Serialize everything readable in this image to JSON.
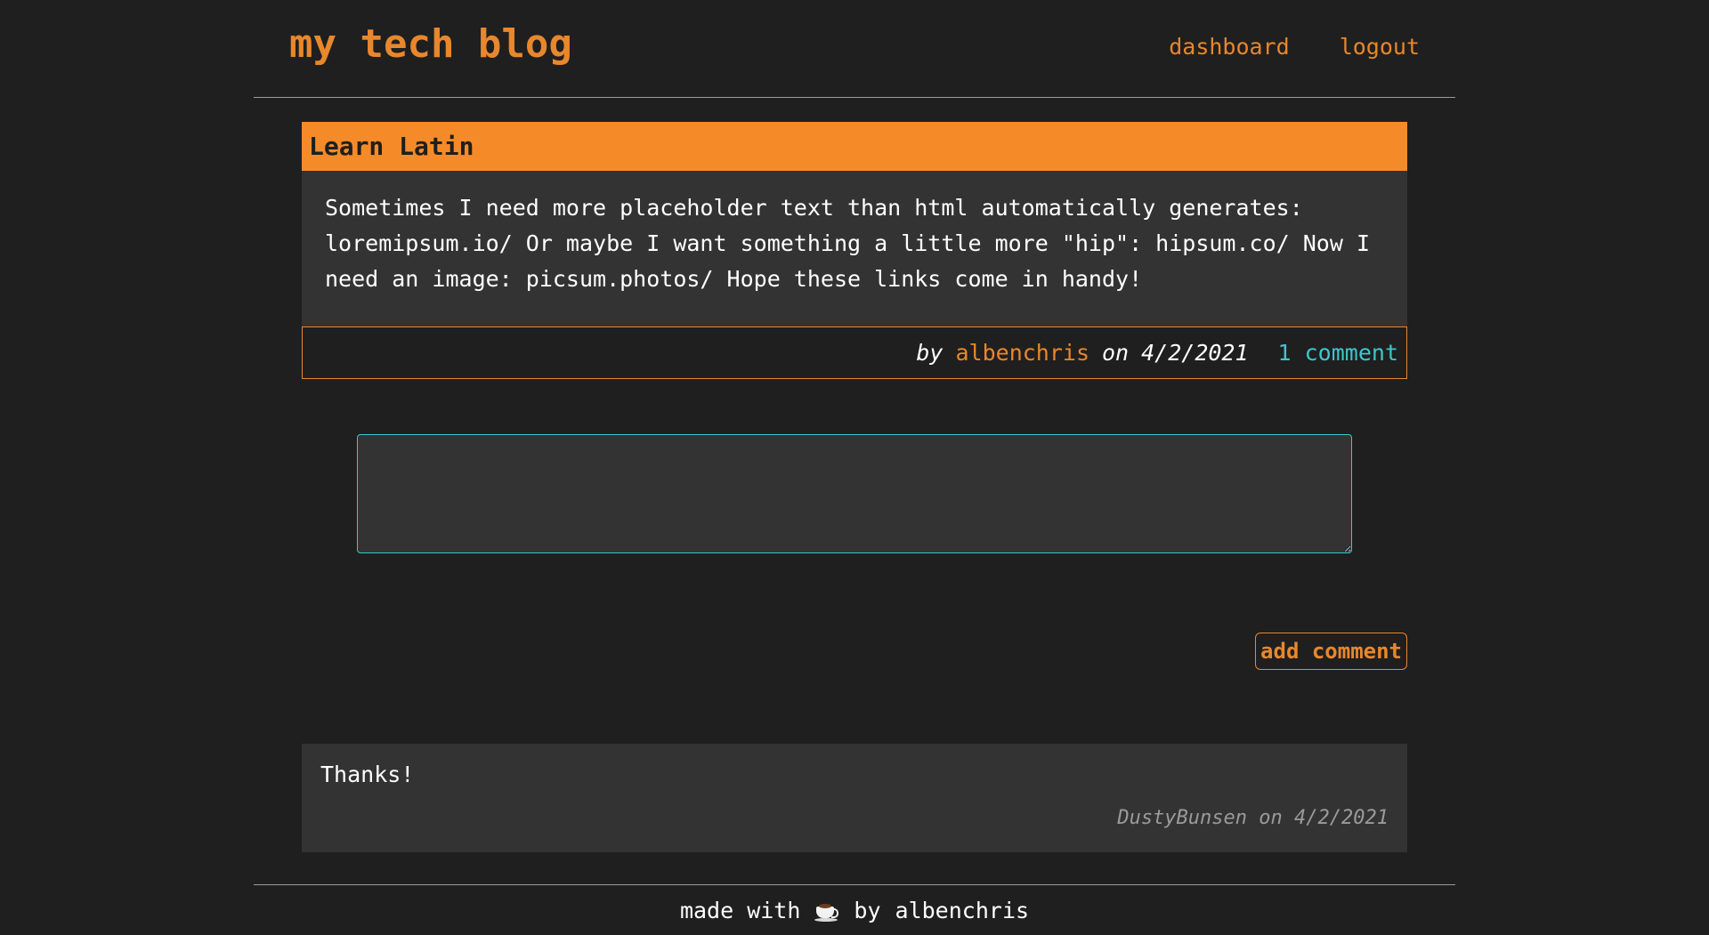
{
  "header": {
    "site_title": "my tech blog",
    "nav": {
      "dashboard": "dashboard",
      "logout": "logout"
    }
  },
  "post": {
    "title": "Learn Latin",
    "body": "Sometimes I need more placeholder text than html automatically generates: loremipsum.io/ Or maybe I want something a little more \"hip\": hipsum.co/ Now I need an image: picsum.photos/ Hope these links come in handy!",
    "by_label": "by",
    "author": "albenchris",
    "on_label": "on",
    "date": "4/2/2021",
    "comment_count_label": "1 comment"
  },
  "comment_form": {
    "input_value": "",
    "submit_label": "add comment"
  },
  "comments": [
    {
      "text": "Thanks!",
      "author": "DustyBunsen",
      "on_label": "on",
      "date": "4/2/2021"
    }
  ],
  "footer": {
    "made_with": "made with",
    "icon": "coffee-icon",
    "by": "by",
    "author": "albenchris"
  },
  "colors": {
    "background": "#1f1f1f",
    "accent": "#e8872c",
    "header_bar": "#f58b28",
    "link": "#3ec6cc",
    "card": "#333333"
  }
}
